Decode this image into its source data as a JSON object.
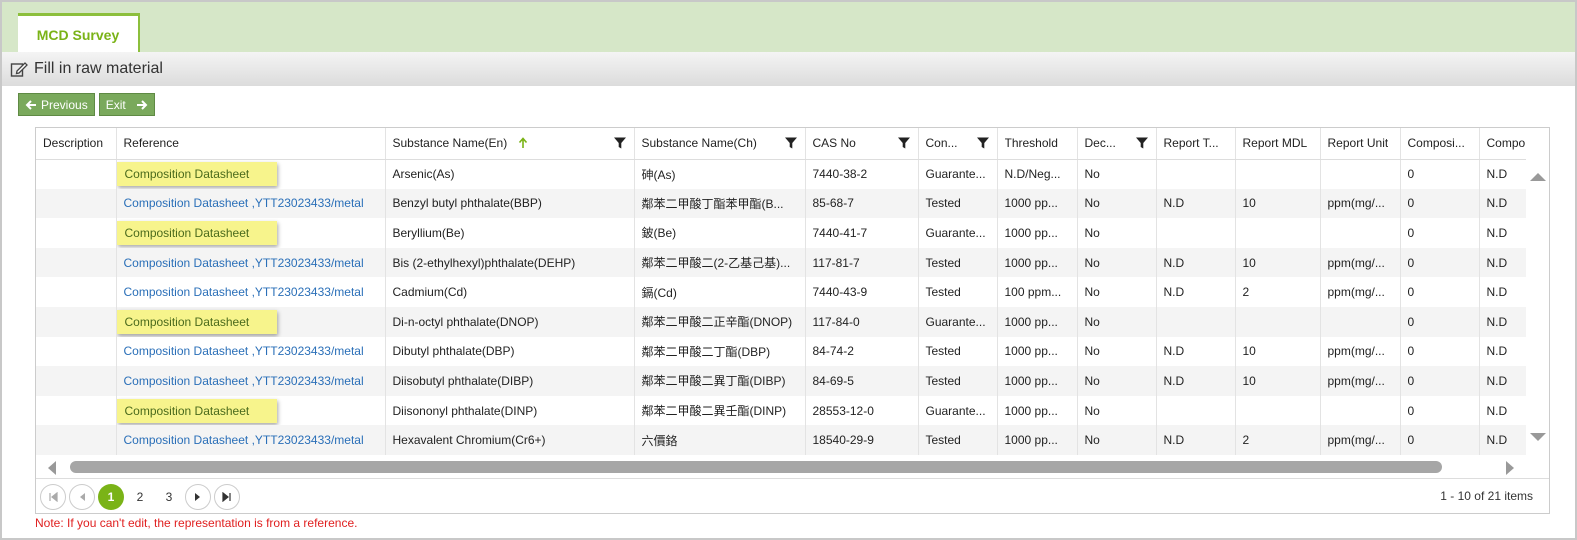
{
  "tab": {
    "label": "MCD Survey"
  },
  "section": {
    "title": "Fill in raw material"
  },
  "buttons": {
    "previous": "Previous",
    "exit": "Exit"
  },
  "columns": [
    {
      "label": "Description",
      "filter": false,
      "sort": false
    },
    {
      "label": "Reference",
      "filter": false,
      "sort": false
    },
    {
      "label": "Substance Name(En)",
      "filter": true,
      "sort": true
    },
    {
      "label": "Substance Name(Ch)",
      "filter": true,
      "sort": false
    },
    {
      "label": "CAS No",
      "filter": true,
      "sort": false
    },
    {
      "label": "Con...",
      "filter": true,
      "sort": false
    },
    {
      "label": "Threshold",
      "filter": false,
      "sort": false
    },
    {
      "label": "Dec...",
      "filter": true,
      "sort": false
    },
    {
      "label": "Report T...",
      "filter": false,
      "sort": false
    },
    {
      "label": "Report MDL",
      "filter": false,
      "sort": false
    },
    {
      "label": "Report Unit",
      "filter": false,
      "sort": false
    },
    {
      "label": "Composi...",
      "filter": false,
      "sort": false
    },
    {
      "label": "Compo",
      "filter": false,
      "sort": false
    }
  ],
  "rows": [
    {
      "ref": "Composition Datasheet",
      "highlight": true,
      "en": "Arsenic(As)",
      "ch": "砷(As)",
      "cas": "7440-38-2",
      "con": "Guarante...",
      "threshold": "N.D/Neg...",
      "dec": "No",
      "rt": "",
      "mdl": "",
      "unit": "",
      "comp": "0",
      "comp2": "N.D"
    },
    {
      "ref": "Composition Datasheet ,YTT23023433/metal",
      "highlight": false,
      "en": "Benzyl butyl phthalate(BBP)",
      "ch": "鄰苯二甲酸丁酯苯甲酯(B...",
      "cas": "85-68-7",
      "con": "Tested",
      "threshold": "1000 pp...",
      "dec": "No",
      "rt": "N.D",
      "mdl": "10",
      "unit": "ppm(mg/...",
      "comp": "0",
      "comp2": "N.D"
    },
    {
      "ref": "Composition Datasheet",
      "highlight": true,
      "en": "Beryllium(Be)",
      "ch": "鈹(Be)",
      "cas": "7440-41-7",
      "con": "Guarante...",
      "threshold": "1000 pp...",
      "dec": "No",
      "rt": "",
      "mdl": "",
      "unit": "",
      "comp": "0",
      "comp2": "N.D"
    },
    {
      "ref": "Composition Datasheet ,YTT23023433/metal",
      "highlight": false,
      "en": "Bis (2-ethylhexyl)phthalate(DEHP)",
      "ch": "鄰苯二甲酸二(2-乙基己基)...",
      "cas": "117-81-7",
      "con": "Tested",
      "threshold": "1000 pp...",
      "dec": "No",
      "rt": "N.D",
      "mdl": "10",
      "unit": "ppm(mg/...",
      "comp": "0",
      "comp2": "N.D"
    },
    {
      "ref": "Composition Datasheet ,YTT23023433/metal",
      "highlight": false,
      "en": "Cadmium(Cd)",
      "ch": "鎘(Cd)",
      "cas": "7440-43-9",
      "con": "Tested",
      "threshold": "100 ppm...",
      "dec": "No",
      "rt": "N.D",
      "mdl": "2",
      "unit": "ppm(mg/...",
      "comp": "0",
      "comp2": "N.D"
    },
    {
      "ref": "Composition Datasheet",
      "highlight": true,
      "en": "Di-n-octyl phthalate(DNOP)",
      "ch": "鄰苯二甲酸二正辛酯(DNOP)",
      "cas": "117-84-0",
      "con": "Guarante...",
      "threshold": "1000 pp...",
      "dec": "No",
      "rt": "",
      "mdl": "",
      "unit": "",
      "comp": "0",
      "comp2": "N.D"
    },
    {
      "ref": "Composition Datasheet ,YTT23023433/metal",
      "highlight": false,
      "en": "Dibutyl phthalate(DBP)",
      "ch": "鄰苯二甲酸二丁酯(DBP)",
      "cas": "84-74-2",
      "con": "Tested",
      "threshold": "1000 pp...",
      "dec": "No",
      "rt": "N.D",
      "mdl": "10",
      "unit": "ppm(mg/...",
      "comp": "0",
      "comp2": "N.D"
    },
    {
      "ref": "Composition Datasheet ,YTT23023433/metal",
      "highlight": false,
      "en": "Diisobutyl phthalate(DIBP)",
      "ch": "鄰苯二甲酸二異丁酯(DIBP)",
      "cas": "84-69-5",
      "con": "Tested",
      "threshold": "1000 pp...",
      "dec": "No",
      "rt": "N.D",
      "mdl": "10",
      "unit": "ppm(mg/...",
      "comp": "0",
      "comp2": "N.D"
    },
    {
      "ref": "Composition Datasheet",
      "highlight": true,
      "en": "Diisononyl phthalate(DINP)",
      "ch": "鄰苯二甲酸二異壬酯(DINP)",
      "cas": "28553-12-0",
      "con": "Guarante...",
      "threshold": "1000 pp...",
      "dec": "No",
      "rt": "",
      "mdl": "",
      "unit": "",
      "comp": "0",
      "comp2": "N.D"
    },
    {
      "ref": "Composition Datasheet ,YTT23023433/metal",
      "highlight": false,
      "en": "Hexavalent Chromium(Cr6+)",
      "ch": "六價鉻",
      "cas": "18540-29-9",
      "con": "Tested",
      "threshold": "1000 pp...",
      "dec": "No",
      "rt": "N.D",
      "mdl": "2",
      "unit": "ppm(mg/...",
      "comp": "0",
      "comp2": "N.D"
    }
  ],
  "pager": {
    "pages": [
      "1",
      "2",
      "3"
    ],
    "active": "1",
    "info": "1 - 10 of 21 items"
  },
  "note": "Note: If you can't edit, the representation is from a reference.",
  "colors": {
    "accent": "#7ab317",
    "tabbar": "#d6e7c8",
    "button": "#7aa95c",
    "link": "#2a6fb8",
    "highlight": "#f7f48c",
    "note": "#e02020"
  }
}
